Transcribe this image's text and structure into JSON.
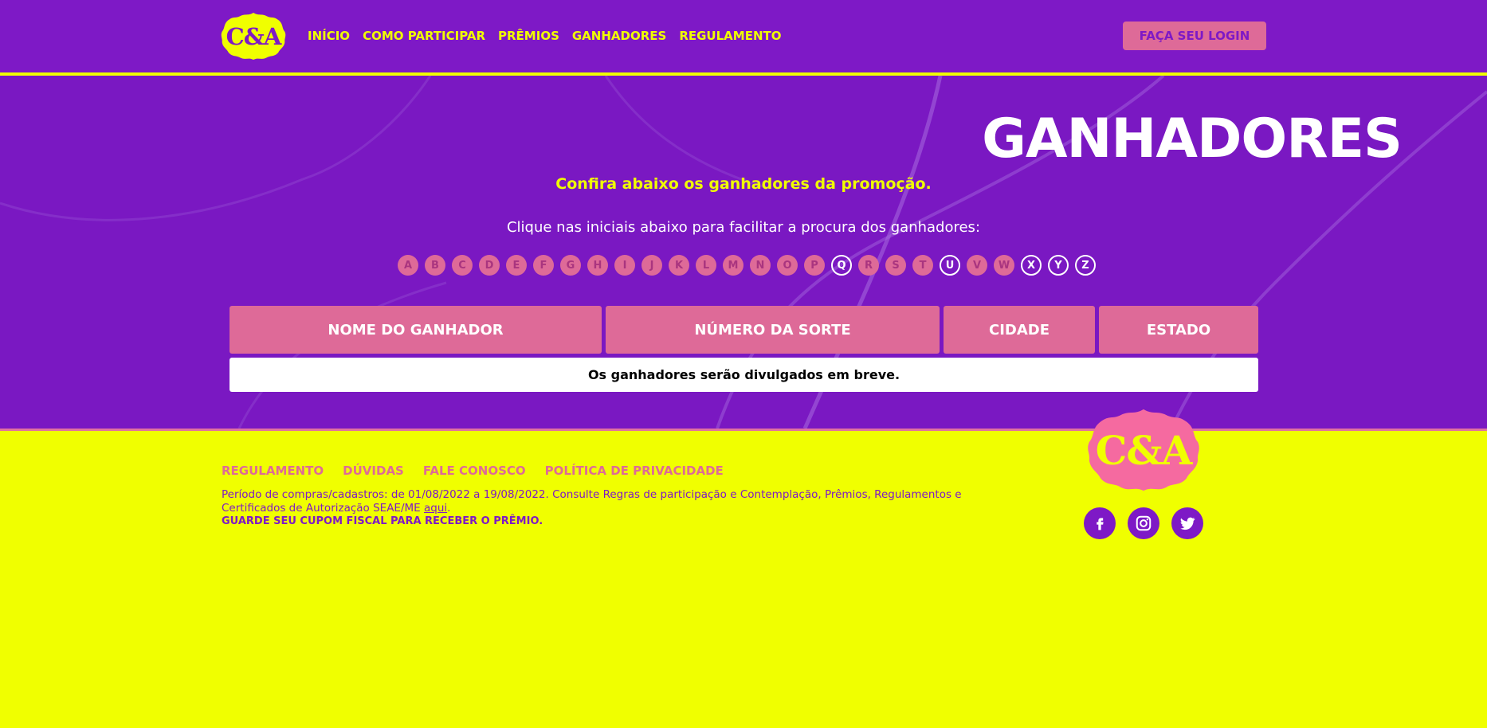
{
  "colors": {
    "purple": "#7e19c6",
    "yellow": "#f0ff00",
    "pink": "#de6a98",
    "white": "#ffffff"
  },
  "header": {
    "logo_text": "C&A",
    "nav": [
      "INÍCIO",
      "COMO PARTICIPAR",
      "PRÊMIOS",
      "GANHADORES",
      "REGULAMENTO"
    ],
    "login_label": "FAÇA SEU LOGIN"
  },
  "hero": {
    "title": "GANHADORES",
    "subtitle": "Confira abaixo os ganhadores da promoção.",
    "instruction": "Clique nas iniciais abaixo para facilitar a procura dos ganhadores:",
    "letters": [
      {
        "l": "A",
        "active": false
      },
      {
        "l": "B",
        "active": false
      },
      {
        "l": "C",
        "active": false
      },
      {
        "l": "D",
        "active": false
      },
      {
        "l": "E",
        "active": false
      },
      {
        "l": "F",
        "active": false
      },
      {
        "l": "G",
        "active": false
      },
      {
        "l": "H",
        "active": false
      },
      {
        "l": "I",
        "active": false
      },
      {
        "l": "J",
        "active": false
      },
      {
        "l": "K",
        "active": false
      },
      {
        "l": "L",
        "active": false
      },
      {
        "l": "M",
        "active": false
      },
      {
        "l": "N",
        "active": false
      },
      {
        "l": "O",
        "active": false
      },
      {
        "l": "P",
        "active": false
      },
      {
        "l": "Q",
        "active": true
      },
      {
        "l": "R",
        "active": false
      },
      {
        "l": "S",
        "active": false
      },
      {
        "l": "T",
        "active": false
      },
      {
        "l": "U",
        "active": true
      },
      {
        "l": "V",
        "active": false
      },
      {
        "l": "W",
        "active": false
      },
      {
        "l": "X",
        "active": true
      },
      {
        "l": "Y",
        "active": true
      },
      {
        "l": "Z",
        "active": true
      }
    ]
  },
  "table": {
    "headers": [
      "NOME DO GANHADOR",
      "NÚMERO DA SORTE",
      "CIDADE",
      "ESTADO"
    ],
    "empty_message": "Os ganhadores serão divulgados em breve."
  },
  "footer": {
    "links": [
      "REGULAMENTO",
      "DÚVIDAS",
      "FALE CONOSCO",
      "POLÍTICA DE PRIVACIDADE"
    ],
    "legal_text": "Período de compras/cadastros: de 01/08/2022 a 19/08/2022. Consulte Regras de participação e Contemplação, Prêmios, Regulamentos e Certificados de Autorização SEAE/ME ",
    "legal_link": "aqui",
    "legal_end": ".",
    "legal_bold": "GUARDE SEU CUPOM FISCAL PARA RECEBER O PRÊMIO.",
    "logo_text": "C&A",
    "social": [
      "facebook-icon",
      "instagram-icon",
      "twitter-icon"
    ]
  }
}
